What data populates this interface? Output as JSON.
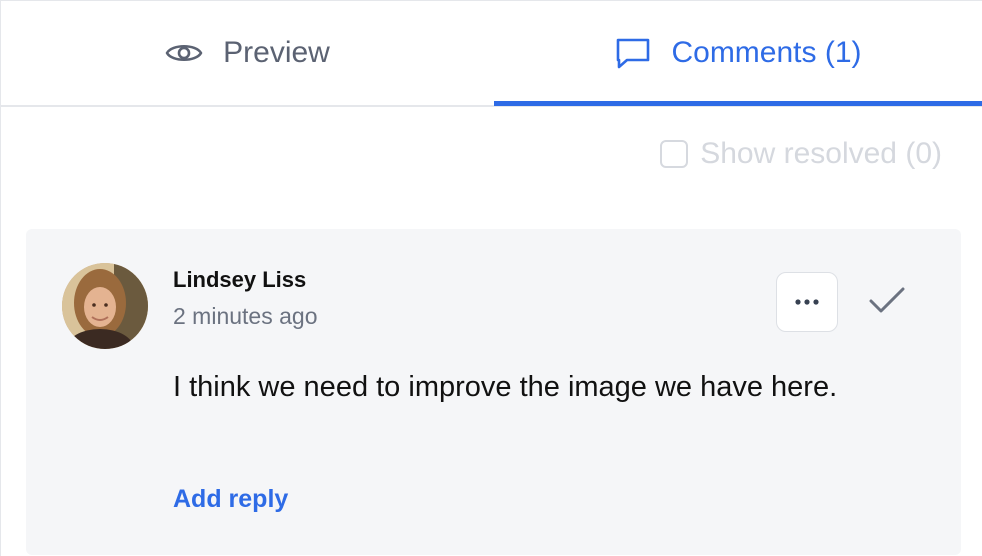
{
  "tabs": {
    "preview_label": "Preview",
    "comments_label": "Comments (1)",
    "active": "comments",
    "preview_icon": "eye-icon",
    "comments_icon": "speech-bubble-icon"
  },
  "filter": {
    "show_resolved_label": "Show resolved (0)",
    "show_resolved_checked": false
  },
  "comment": {
    "author": "Lindsey Liss",
    "timestamp": "2 minutes ago",
    "text": "I think we need to improve the image we have here.",
    "add_reply_label": "Add reply",
    "more_icon": "more-horizontal-icon",
    "resolve_icon": "checkmark-icon"
  },
  "colors": {
    "accent": "#2e6be6",
    "muted_text": "#6b7280",
    "card_bg": "#f5f6f8",
    "disabled_text": "#d5d8de"
  }
}
